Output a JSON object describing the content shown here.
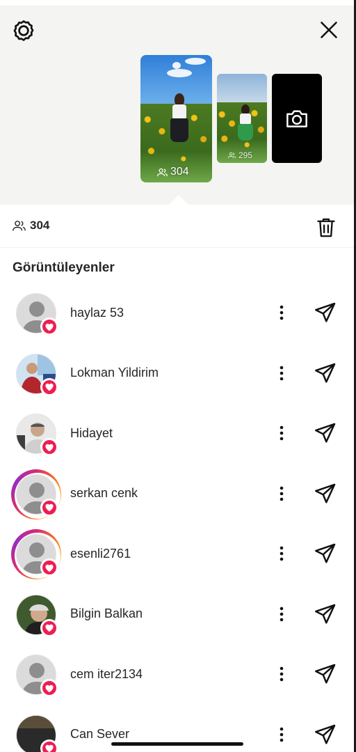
{
  "header": {
    "settings_icon": "gear-icon",
    "close_icon": "close-icon"
  },
  "stories": {
    "current_count": "304",
    "previous_count": "295",
    "camera_icon": "camera-icon"
  },
  "viewer_bar": {
    "count": "304",
    "delete_icon": "trash-icon"
  },
  "section_title": "Görüntüleyenler",
  "viewers": [
    {
      "name": "haylaz 53",
      "avatar": "default",
      "ring": false
    },
    {
      "name": "Lokman Yildirim",
      "avatar": "photo-red-shirt",
      "ring": false
    },
    {
      "name": "Hidayet",
      "avatar": "photo-man",
      "ring": false
    },
    {
      "name": "serkan cenk",
      "avatar": "default",
      "ring": true
    },
    {
      "name": "esenli2761",
      "avatar": "default",
      "ring": true
    },
    {
      "name": "Bilgin Balkan",
      "avatar": "photo-beanie",
      "ring": false
    },
    {
      "name": "cem iter2134",
      "avatar": "default",
      "ring": false
    },
    {
      "name": "Can Sever",
      "avatar": "photo-dark",
      "ring": false
    }
  ],
  "colors": {
    "heart_badge": "#ee1d52",
    "top_background": "#f4f4f2",
    "text": "#262626"
  }
}
